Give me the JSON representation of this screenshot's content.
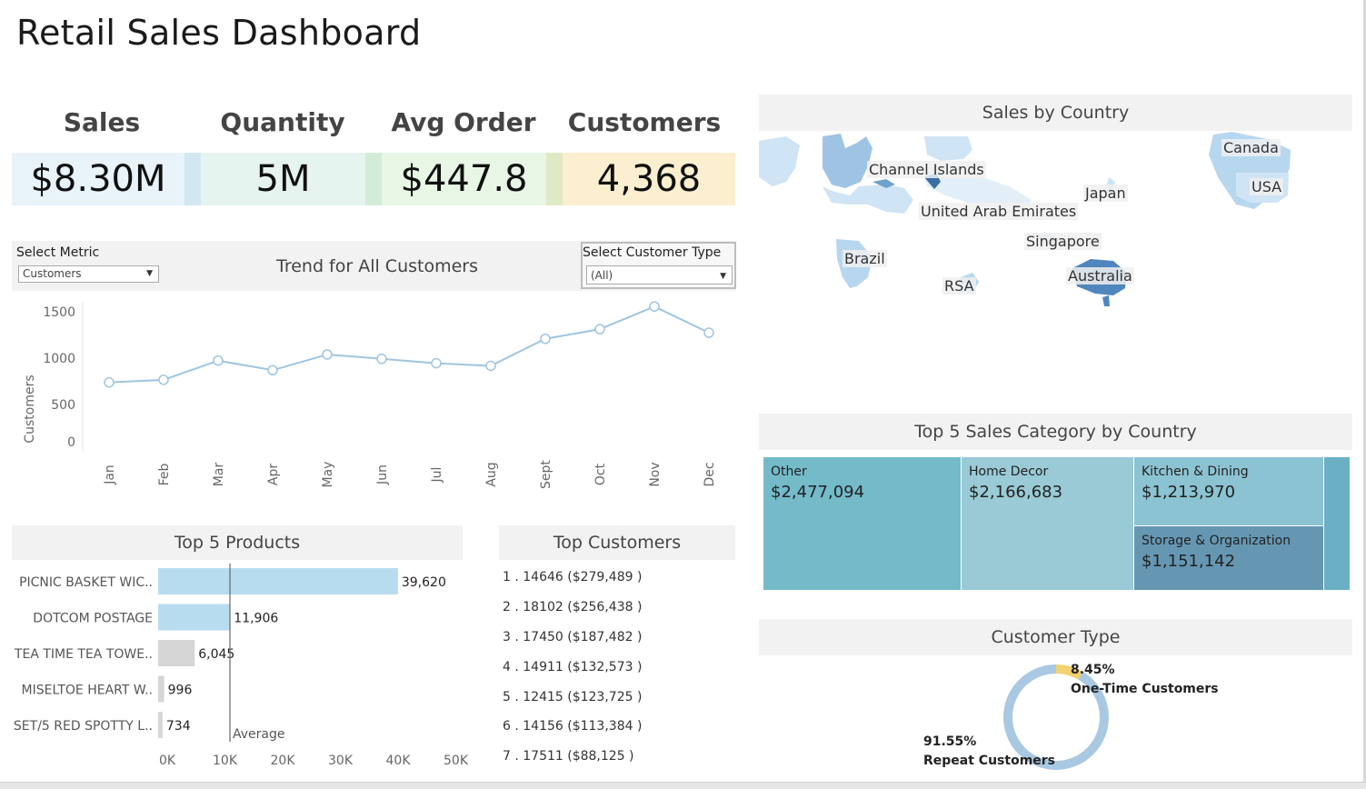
{
  "title": "Retail Sales Dashboard",
  "kpis": [
    {
      "label": "Sales",
      "value": "$8.30M",
      "bg": "#e8f3fa",
      "strip": "#d2e7f1"
    },
    {
      "label": "Quantity",
      "value": "5M",
      "bg": "#e6f4ef",
      "strip": "#d3ebd9"
    },
    {
      "label": "Avg Order",
      "value": "$447.8",
      "bg": "#e7f6e5",
      "strip": "#e0e9c6"
    },
    {
      "label": "Customers",
      "value": "4,368",
      "bg": "#fbefd0",
      "strip": "#f6e6b5"
    }
  ],
  "trend": {
    "select_metric_label": "Select Metric",
    "select_metric_value": "Customers",
    "title": "Trend for All Customers",
    "customer_type_label": "Select Customer Type",
    "customer_type_value": "(All)",
    "ylabel": "Customers",
    "yticks": [
      "1500",
      "1000",
      "500",
      "0"
    ]
  },
  "chart_data": [
    {
      "type": "line",
      "title": "Trend for All Customers",
      "ylabel": "Customers",
      "categories": [
        "Jan",
        "Feb",
        "Mar",
        "Apr",
        "May",
        "Jun",
        "Jul",
        "Aug",
        "Sept",
        "Oct",
        "Nov",
        "Dec"
      ],
      "values": [
        680,
        710,
        930,
        820,
        1000,
        950,
        900,
        870,
        1180,
        1290,
        1550,
        1250
      ],
      "ylim": [
        0,
        1600
      ],
      "color": "#9ec5e1"
    },
    {
      "type": "bar",
      "title": "Top 5  Products",
      "categories": [
        "PICNIC BASKET WIC..",
        "DOTCOM POSTAGE",
        "TEA TIME TEA TOWE..",
        "MISELTOE HEART W..",
        "SET/5 RED SPOTTY L.."
      ],
      "values": [
        39620,
        11906,
        6045,
        996,
        734
      ],
      "value_labels": [
        "39,620",
        "11,906",
        "6,045",
        "996",
        "734"
      ],
      "average": 11860,
      "average_label": "Average",
      "xlim": [
        0,
        50000
      ],
      "xticks": [
        "0K",
        "10K",
        "20K",
        "30K",
        "40K",
        "50K"
      ],
      "above_avg_color": "#b8dcef",
      "below_avg_color": "#d6d6d6"
    },
    {
      "type": "pie",
      "title": "Customer Type",
      "slices": [
        {
          "name": "One-Time Customers",
          "value": 8.45,
          "label": "8.45%",
          "color": "#f3d36f"
        },
        {
          "name": "Repeat Customers",
          "value": 91.55,
          "label": "91.55%",
          "color": "#a9c9e3"
        }
      ]
    }
  ],
  "top_customers": {
    "title": "Top Customers",
    "rows": [
      "1 . 14646 ($279,489 )",
      "2 . 18102 ($256,438 )",
      "3 . 17450 ($187,482 )",
      "4 . 14911 ($132,573 )",
      "5 . 12415 ($123,725 )",
      "6 . 14156 ($113,384 )",
      "7 . 17511 ($88,125 )"
    ]
  },
  "products_title": "Top 5  Products",
  "map": {
    "title": "Sales by Country",
    "labels": [
      "Canada",
      "Channel Islands",
      "Japan",
      "USA",
      "United Arab Emirates",
      "Singapore",
      "Brazil",
      "Australia",
      "RSA"
    ]
  },
  "treemap": {
    "title": "Top 5 Sales Category by Country",
    "cells": [
      {
        "category": "Other",
        "value": "$2,477,094",
        "color": "#74bac9"
      },
      {
        "category": "Home Decor",
        "value": "$2,166,683",
        "color": "#99cad6"
      },
      {
        "category": "Kitchen & Dining",
        "value": "$1,213,970",
        "color": "#8cc3d2"
      },
      {
        "category": "Storage & Organization",
        "value": "$1,151,142",
        "color": "#6597b3"
      }
    ],
    "extra_color": "#6aafc4"
  },
  "customer_type": {
    "title": "Customer Type",
    "one_time_pct": "8.45%",
    "one_time_label": "One-Time Customers",
    "repeat_pct": "91.55%",
    "repeat_label": "Repeat Customers"
  }
}
